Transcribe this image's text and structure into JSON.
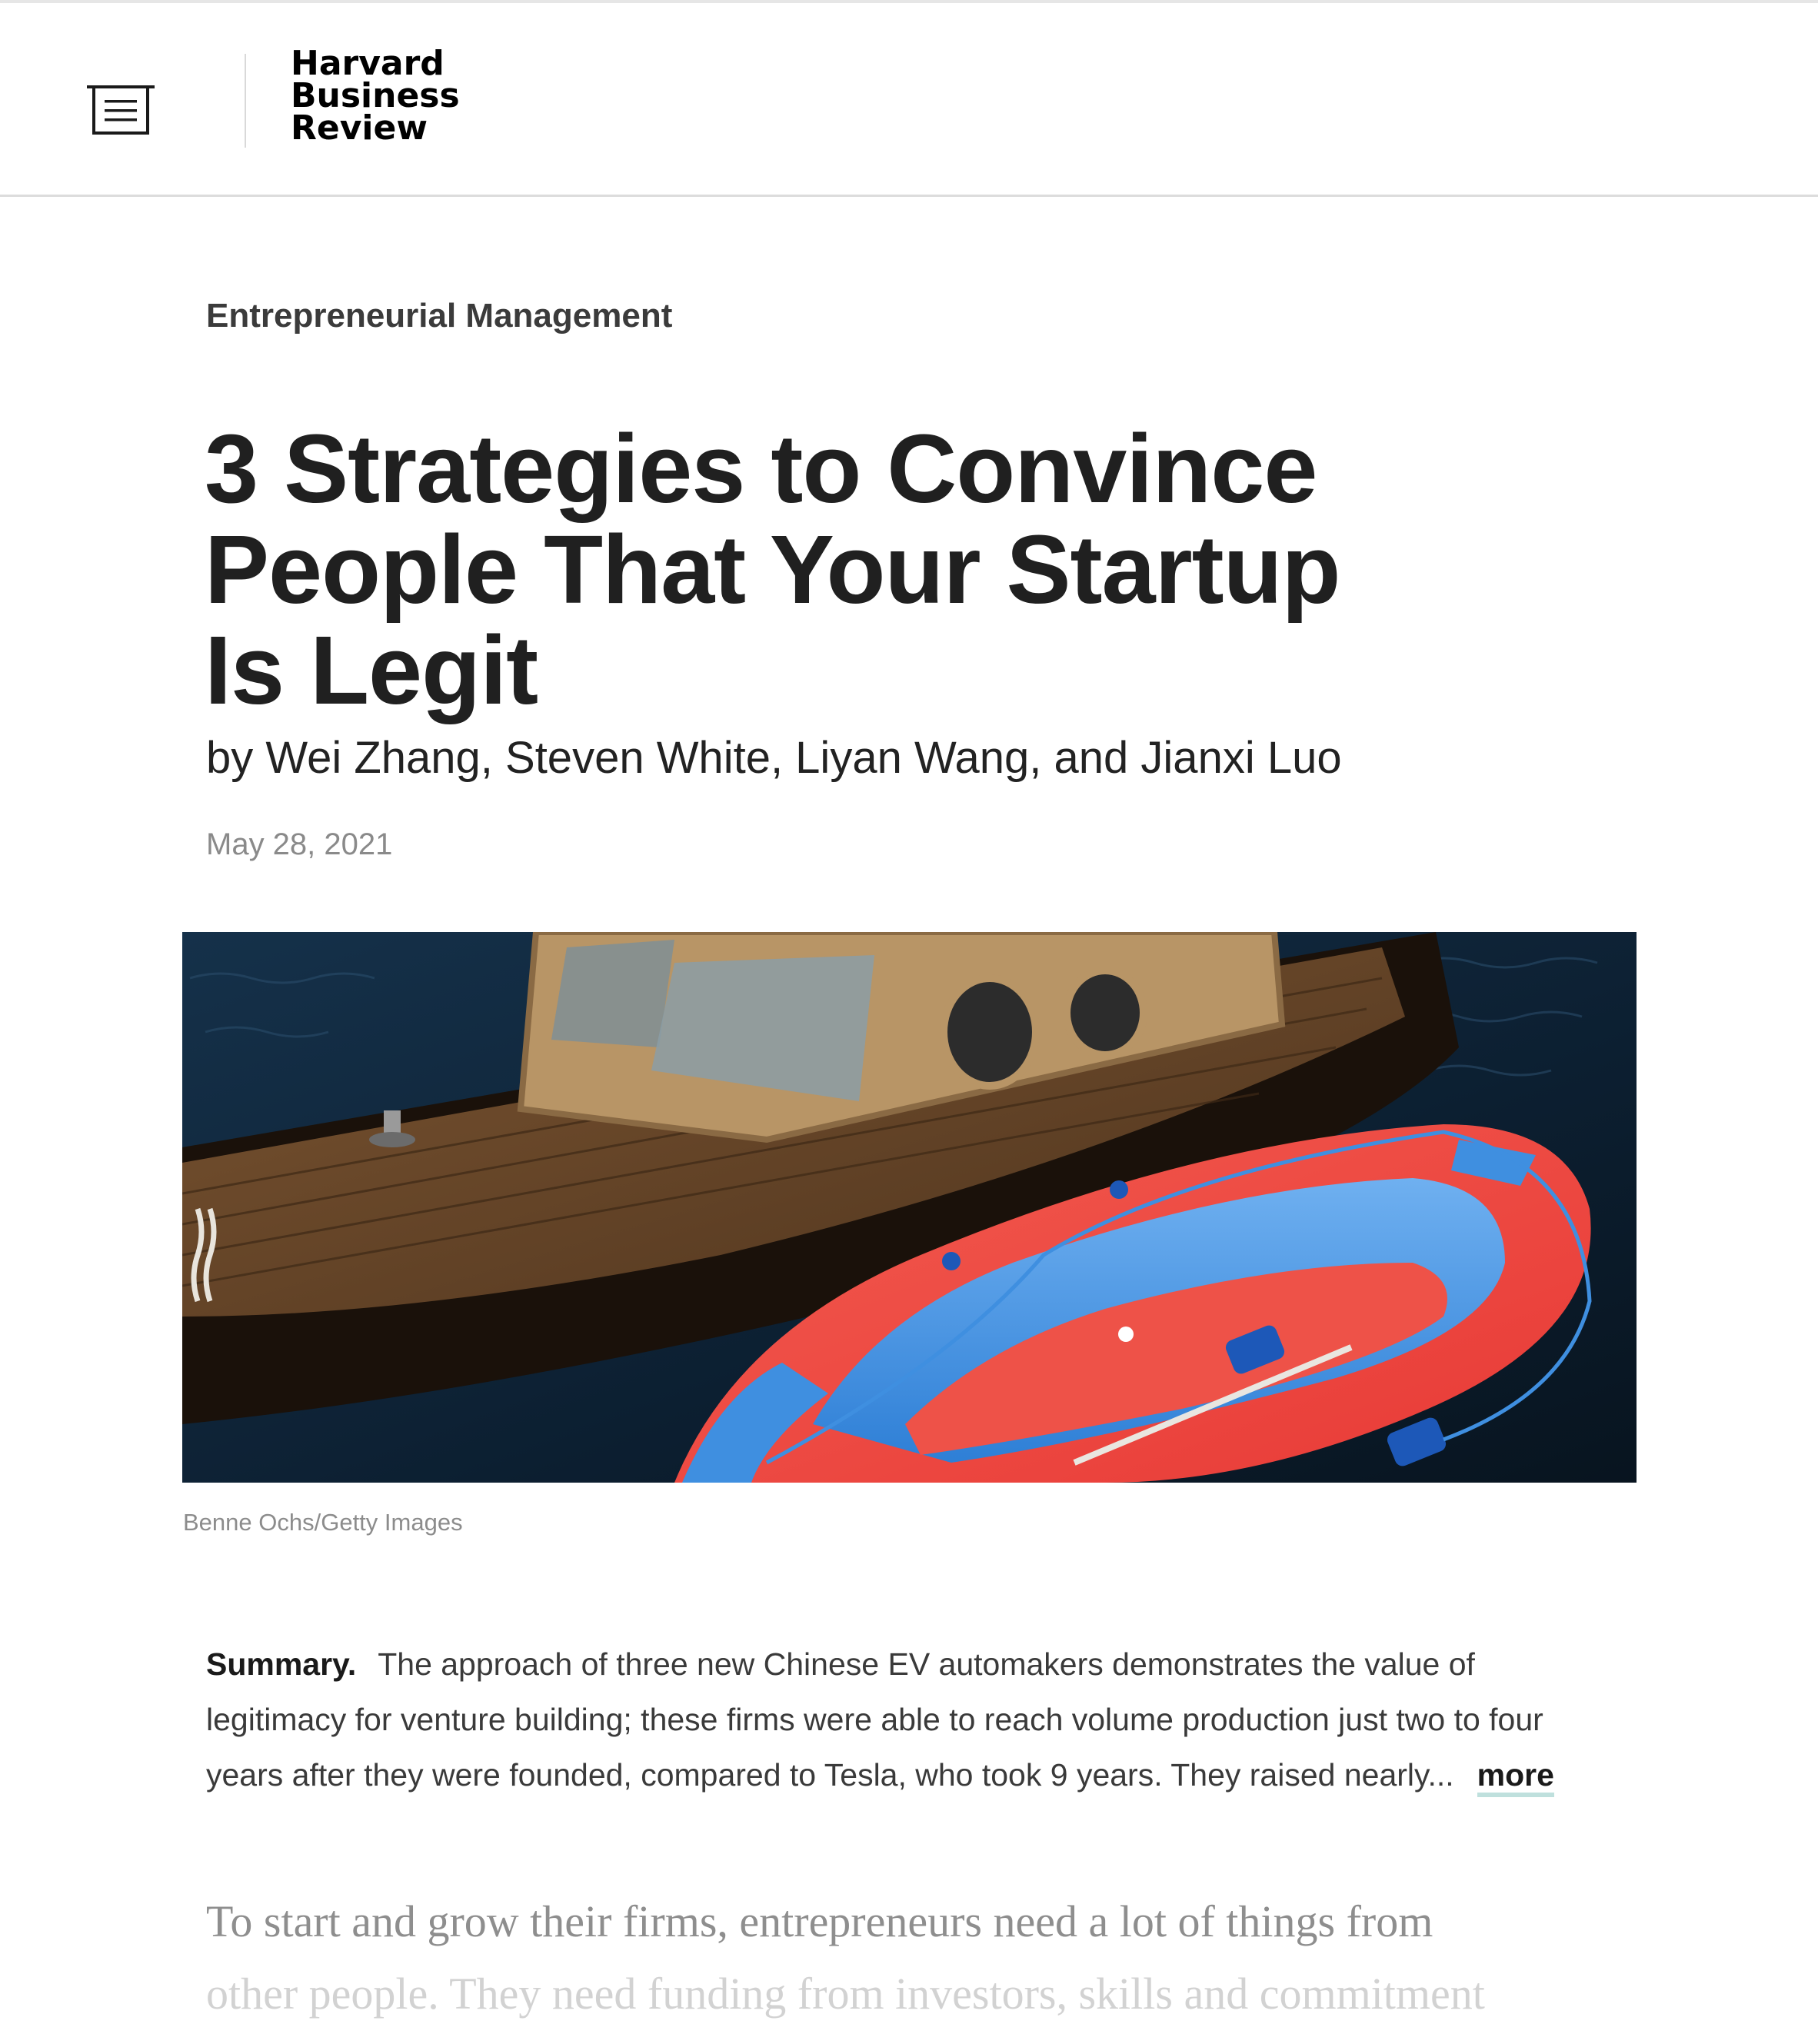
{
  "header": {
    "logo_lines": [
      "Harvard",
      "Business",
      "Review"
    ]
  },
  "article": {
    "topic": "Entrepreneurial Management",
    "title_lines": [
      "3 Strategies to Convince",
      "People That Your Startup",
      "Is Legit"
    ],
    "byline": "by Wei Zhang, Steven White, Liyan Wang, and Jianxi Luo",
    "date": "May 28, 2021",
    "image_credit": "Benne Ochs/Getty Images",
    "summary": {
      "label": "Summary.",
      "lines": [
        "The approach of three new Chinese EV automakers demonstrates the value of",
        "legitimacy for venture building; these firms were able to reach volume production just two to four",
        "years after they were founded, compared to Tesla, who took 9 years. They raised nearly..."
      ],
      "more_label": "more"
    },
    "body_lines": [
      "To start and grow their firms, entrepreneurs need a lot of things from",
      "other people. They need funding from investors, skills and commitment"
    ]
  },
  "icons": {
    "menu": "menu-list-icon"
  },
  "colors": {
    "raft_red": "#ee4a43",
    "raft_blue": "#3f8fe0",
    "water": "#0e2436",
    "wood": "#6b4a2a",
    "more_underline": "#bfe0dd"
  }
}
